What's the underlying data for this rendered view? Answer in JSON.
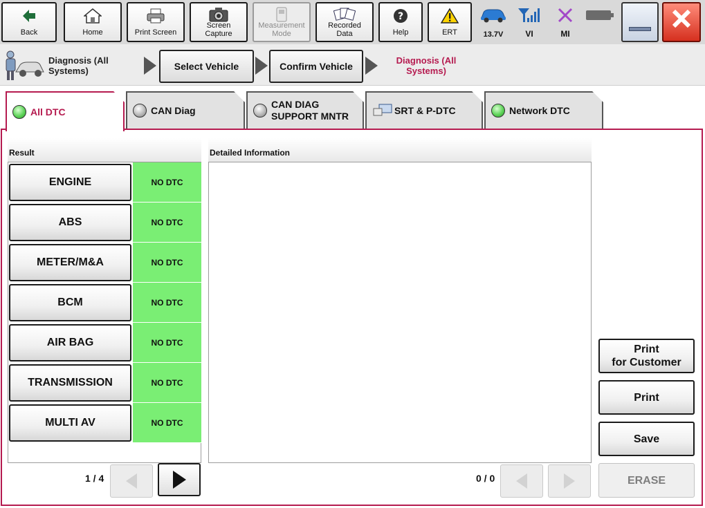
{
  "toolbar": {
    "back": "Back",
    "home": "Home",
    "print_screen": "Print Screen",
    "screen_capture_1": "Screen",
    "screen_capture_2": "Capture",
    "measurement_mode_1": "Measurement",
    "measurement_mode_2": "Mode",
    "recorded_data_1": "Recorded",
    "recorded_data_2": "Data",
    "help": "Help",
    "ert": "ERT",
    "battery_voltage": "13.7V",
    "vi_label": "VI",
    "mi_label": "MI"
  },
  "breadcrumb": {
    "step1_line1": "Diagnosis (All",
    "step1_line2": "Systems)",
    "select_vehicle": "Select Vehicle",
    "confirm_vehicle": "Confirm Vehicle",
    "current_line1": "Diagnosis (All",
    "current_line2": "Systems)"
  },
  "tabs": [
    {
      "label": "All DTC"
    },
    {
      "label": "CAN Diag"
    },
    {
      "label_line1": "CAN DIAG",
      "label_line2": "SUPPORT MNTR"
    },
    {
      "label": "SRT & P-DTC"
    },
    {
      "label": "Network DTC"
    }
  ],
  "result": {
    "header": "Result",
    "rows": [
      {
        "system": "ENGINE",
        "status": "NO DTC"
      },
      {
        "system": "ABS",
        "status": "NO DTC"
      },
      {
        "system": "METER/M&A",
        "status": "NO DTC"
      },
      {
        "system": "BCM",
        "status": "NO DTC"
      },
      {
        "system": "AIR BAG",
        "status": "NO DTC"
      },
      {
        "system": "TRANSMISSION",
        "status": "NO DTC"
      },
      {
        "system": "MULTI AV",
        "status": "NO DTC"
      }
    ],
    "page": "1 / 4"
  },
  "detail": {
    "header": "Detailed Information",
    "page": "0 / 0"
  },
  "actions": {
    "print_customer_1": "Print",
    "print_customer_2": "for Customer",
    "print": "Print",
    "save": "Save",
    "erase": "ERASE"
  },
  "colors": {
    "accent": "#b51a4f",
    "no_dtc_green": "#7aee74",
    "led_green": "#5fd45a"
  }
}
